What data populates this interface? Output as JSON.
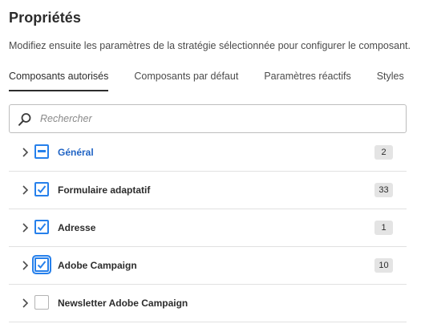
{
  "header": {
    "title": "Propriétés",
    "description": "Modifiez ensuite les paramètres de la stratégie sélectionnée pour configurer le composant."
  },
  "tabs": [
    {
      "label": "Composants autorisés",
      "active": true
    },
    {
      "label": "Composants par défaut",
      "active": false
    },
    {
      "label": "Paramètres réactifs",
      "active": false
    },
    {
      "label": "Styles",
      "active": false
    }
  ],
  "search": {
    "placeholder": "Rechercher",
    "value": "",
    "icon": "magnifier-icon"
  },
  "groups": [
    {
      "label": "Général",
      "count": "2",
      "state": "indeterminate"
    },
    {
      "label": "Formulaire adaptatif",
      "count": "33",
      "state": "checked"
    },
    {
      "label": "Adresse",
      "count": "1",
      "state": "checked"
    },
    {
      "label": "Adobe Campaign",
      "count": "10",
      "state": "checked"
    },
    {
      "label": "Newsletter Adobe Campaign",
      "count": "",
      "state": "unchecked"
    }
  ],
  "colors": {
    "accent": "#2680eb",
    "accent_text": "#1f63c4",
    "badge_bg": "#e4e4e4",
    "divider": "#e1e1e1"
  }
}
